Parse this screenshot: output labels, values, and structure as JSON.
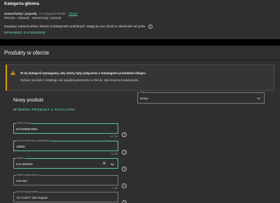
{
  "category": {
    "heading": "Kategoria główna",
    "name": "Samochody i pojazdy",
    "number": "Nr kategorii 88382",
    "change_link": "Zmień",
    "path": "Dziecko · Zabawki · Samochody i pojazdy",
    "info": "Kupujący zobaczą ofertę również w kategoriach podobnych. Mogą się one różnić w zależności od rynku.",
    "info_icon": "?",
    "change_button": "SPRAWDŹ KATEGORIE"
  },
  "products": {
    "title": "Produkty w ofercie",
    "warning": {
      "line1": "W tej kategorii wymagamy, aby oferty były połączone z Katalogiem produktów Allegro.",
      "line2": "Wybierz produkt z Katalogu lub wypełnij parametry w ofercie, aby stworzyć powiązanie.",
      "accent": "#d6a400"
    },
    "new_product": "Nowy produkt",
    "choose_from_catalog": "WYBIERZ PRODUKT Z KATALOGU",
    "stan": {
      "label": "Stan",
      "value": "Nowy"
    },
    "fields": [
      {
        "label": "EAN (GTIN)",
        "value": "074299057854",
        "counter": "12 / 14"
      },
      {
        "label": "Kod producenta (opcjonalnie)",
        "value": "J8805",
        "counter": "5 / 45"
      },
      {
        "label": "Marka",
        "value": "Hot Wheels",
        "counter": ""
      },
      {
        "label": "Seria (opcjonalnie)",
        "value": "HW Dirt",
        "counter": "7 / 40"
      },
      {
        "label": "Model (opcjonalnie)",
        "value": "'17 Ford F-150 Raptor",
        "counter": ""
      }
    ],
    "help_icon": "?"
  },
  "colors": {
    "accent": "#59c3a7",
    "panel": "#2f2f2f",
    "warning": "#d6a400"
  }
}
